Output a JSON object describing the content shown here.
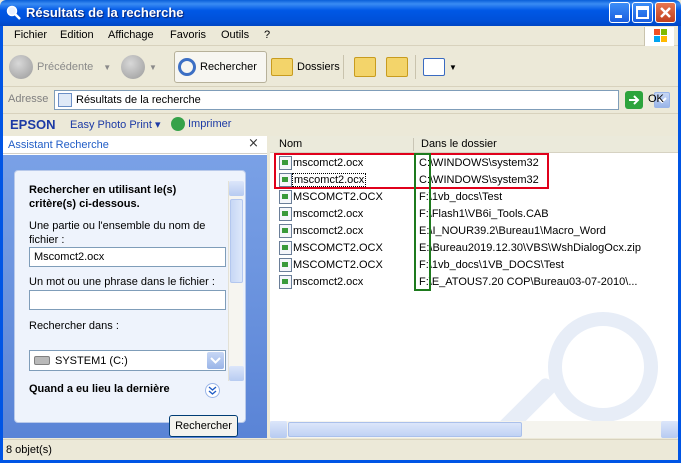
{
  "window": {
    "title": "Résultats de la recherche",
    "min_icon": "minimize-icon",
    "max_icon": "maximize-icon",
    "close_icon": "close-icon"
  },
  "menu": {
    "items": [
      "Fichier",
      "Edition",
      "Affichage",
      "Favoris",
      "Outils",
      "?"
    ]
  },
  "toolbar": {
    "back_label": "Précédente",
    "search_label": "Rechercher",
    "folders_label": "Dossiers"
  },
  "address": {
    "label": "Adresse",
    "value": "Résultats de la recherche",
    "go_label": "OK"
  },
  "epson": {
    "brand": "EPSON",
    "easy_photo_print": "Easy Photo Print",
    "print_label": "Imprimer"
  },
  "left_pane": {
    "title": "Assistant Recherche",
    "close_glyph": "×",
    "heading": "Rechercher en utilisant le(s) critère(s) ci-dessous.",
    "name_label": "Une partie ou l'ensemble du nom de fichier :",
    "name_value": "Mscomct2.ocx",
    "phrase_label": "Un mot ou une phrase dans le fichier :",
    "phrase_value": "",
    "look_in_label": "Rechercher dans :",
    "look_in_value": "SYSTEM1 (C:)",
    "when_label": "Quand a eu lieu la dernière",
    "search_button": "Rechercher"
  },
  "results": {
    "columns": {
      "name": "Nom",
      "folder": "Dans le dossier"
    },
    "rows": [
      {
        "name": "mscomct2.ocx",
        "folder": "C:\\WINDOWS\\system32"
      },
      {
        "name": "mscomct2.ocx",
        "folder": "C:\\WINDOWS\\system32"
      },
      {
        "name": "MSCOMCT2.OCX",
        "folder": "F:\\1vb_docs\\Test"
      },
      {
        "name": "mscomct2.ocx",
        "folder": "F:\\Flash1\\VB6i_Tools.CAB"
      },
      {
        "name": "mscomct2.ocx",
        "folder": "E:\\I_NOUR39.2\\Bureau1\\Macro_Word"
      },
      {
        "name": "MSCOMCT2.OCX",
        "folder": "E:\\Bureau2019.12.30\\VBS\\WshDialogOcx.zip"
      },
      {
        "name": "MSCOMCT2.OCX",
        "folder": "F:\\1vb_docs\\1VB_DOCS\\Test"
      },
      {
        "name": "mscomct2.ocx",
        "folder": "F:\\E_ATOUS7.20 COP\\Bureau03-07-2010\\..."
      }
    ]
  },
  "status": {
    "text": "8 objet(s)"
  },
  "colors": {
    "title_bar": "#0058e6",
    "highlight_red": "#e0001b",
    "highlight_green": "#1d7a1d",
    "link_blue": "#215dc6"
  }
}
